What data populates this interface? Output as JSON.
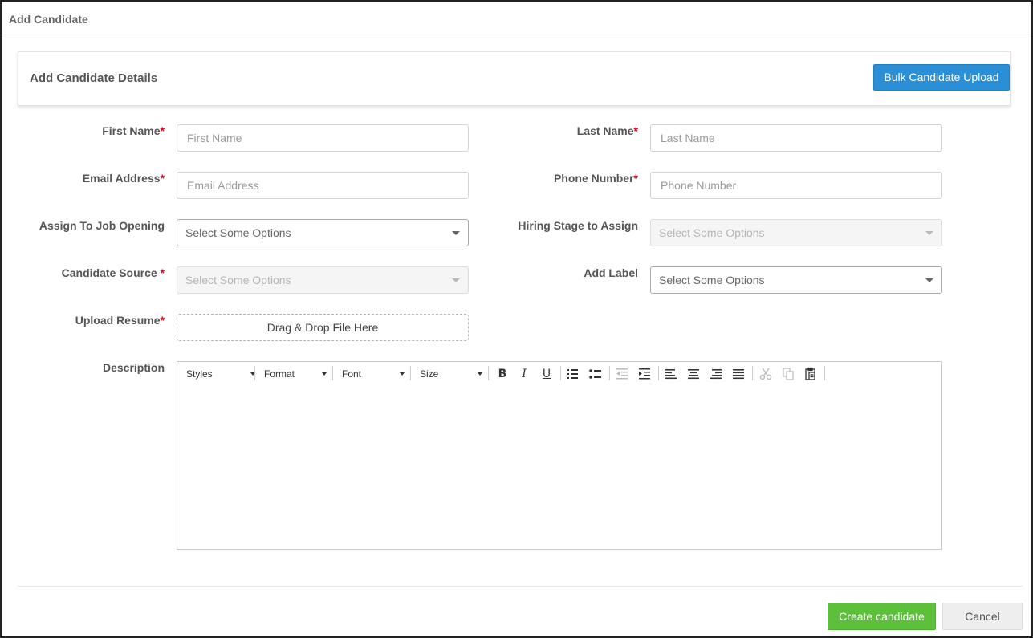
{
  "modal": {
    "title": "Add Candidate"
  },
  "panel": {
    "title": "Add Candidate Details",
    "bulk_upload_label": "Bulk Candidate Upload"
  },
  "form": {
    "first_name": {
      "label": "First Name",
      "required_mark": "*",
      "placeholder": "First Name",
      "value": ""
    },
    "last_name": {
      "label": "Last Name",
      "required_mark": "*",
      "placeholder": "Last Name",
      "value": ""
    },
    "email": {
      "label": "Email Address",
      "required_mark": "*",
      "placeholder": "Email Address",
      "value": ""
    },
    "phone": {
      "label": "Phone Number",
      "required_mark": "*",
      "placeholder": "Phone Number",
      "value": ""
    },
    "job_opening": {
      "label": "Assign To Job Opening",
      "selected": "Select Some Options",
      "enabled": true
    },
    "hiring_stage": {
      "label": "Hiring Stage to Assign",
      "selected": "Select Some Options",
      "enabled": false
    },
    "candidate_source": {
      "label": "Candidate Source ",
      "required_mark": "*",
      "selected": "Select Some Options",
      "enabled": false
    },
    "add_label": {
      "label": "Add Label",
      "selected": "Select Some Options",
      "enabled": true
    },
    "upload_resume": {
      "label": "Upload Resume",
      "required_mark": "*",
      "dropzone_text": "Drag & Drop File Here"
    },
    "description": {
      "label": "Description",
      "toolbar": {
        "styles": "Styles",
        "format": "Format",
        "font": "Font",
        "size": "Size",
        "bold": "B",
        "italic": "I",
        "underline": "U"
      },
      "icons": [
        "numbered-list-icon",
        "bulleted-list-icon",
        "outdent-icon",
        "indent-icon",
        "align-left-icon",
        "align-center-icon",
        "align-right-icon",
        "justify-icon",
        "cut-icon",
        "copy-icon",
        "paste-icon"
      ],
      "value": ""
    }
  },
  "footer": {
    "create_label": "Create candidate",
    "cancel_label": "Cancel"
  },
  "colors": {
    "primary": "#2a8fd6",
    "success": "#5cc03b",
    "required": "#d0021b"
  }
}
